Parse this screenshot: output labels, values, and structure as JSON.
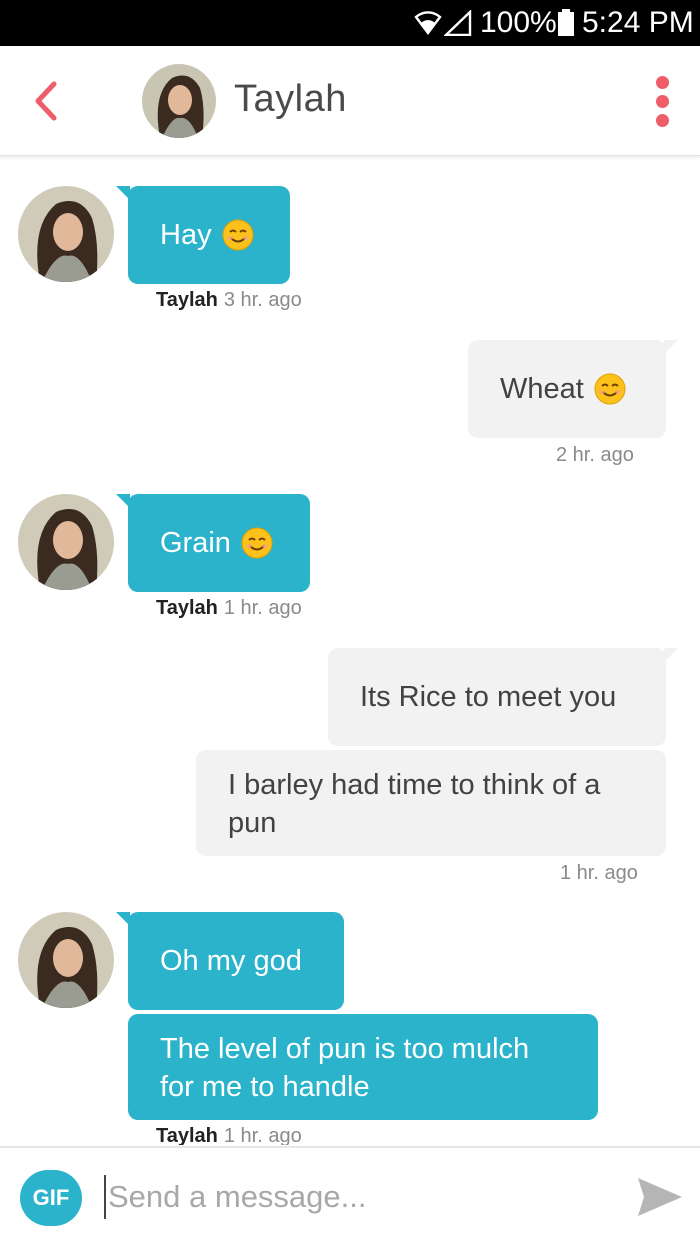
{
  "status_bar": {
    "battery_percent": "100%",
    "time": "5:24 PM"
  },
  "header": {
    "contact_name": "Taylah"
  },
  "messages": [
    {
      "direction": "incoming",
      "text": "Hay",
      "emoji": true
    },
    {
      "direction": "incoming",
      "sender": "Taylah",
      "time": "3 hr. ago"
    },
    {
      "direction": "outgoing",
      "text": "Wheat",
      "emoji": true,
      "time": "2 hr. ago"
    },
    {
      "direction": "incoming",
      "text": "Grain",
      "emoji": true,
      "sender": "Taylah",
      "time": "1 hr. ago"
    },
    {
      "direction": "outgoing",
      "text": "Its Rice to meet you"
    },
    {
      "direction": "outgoing",
      "text": "I barley had time to think of a pun",
      "time": "1 hr. ago"
    },
    {
      "direction": "incoming",
      "text": "Oh my god"
    },
    {
      "direction": "incoming",
      "text": "The level of pun is too mulch for me to handle",
      "sender": "Taylah",
      "time": "1 hr. ago"
    }
  ],
  "composer": {
    "gif_label": "GIF",
    "placeholder": "Send a message..."
  },
  "colors": {
    "incoming": "#2bb3cb",
    "outgoing": "#f2f2f2",
    "accent": "#ef5d6a"
  }
}
